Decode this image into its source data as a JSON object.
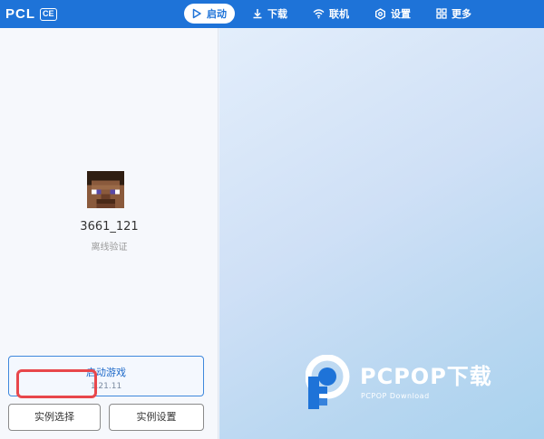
{
  "app": {
    "brand": "PCL",
    "badge": "CE"
  },
  "nav": [
    {
      "label": "启动",
      "icon": "play-icon",
      "active": true
    },
    {
      "label": "下载",
      "icon": "download-icon",
      "active": false
    },
    {
      "label": "联机",
      "icon": "wifi-icon",
      "active": false
    },
    {
      "label": "设置",
      "icon": "gear-icon",
      "active": false
    },
    {
      "label": "更多",
      "icon": "grid-icon",
      "active": false
    }
  ],
  "profile": {
    "username": "3661_121",
    "auth_type": "离线验证"
  },
  "launch": {
    "title": "启动游戏",
    "version": "1.21.11"
  },
  "buttons": {
    "instance_select": "实例选择",
    "instance_settings": "实例设置"
  },
  "watermark": {
    "text": "PCPOP下载",
    "sub": "PCPOP Download"
  },
  "colors": {
    "accent": "#1e73d8",
    "highlight": "#e8474b"
  }
}
